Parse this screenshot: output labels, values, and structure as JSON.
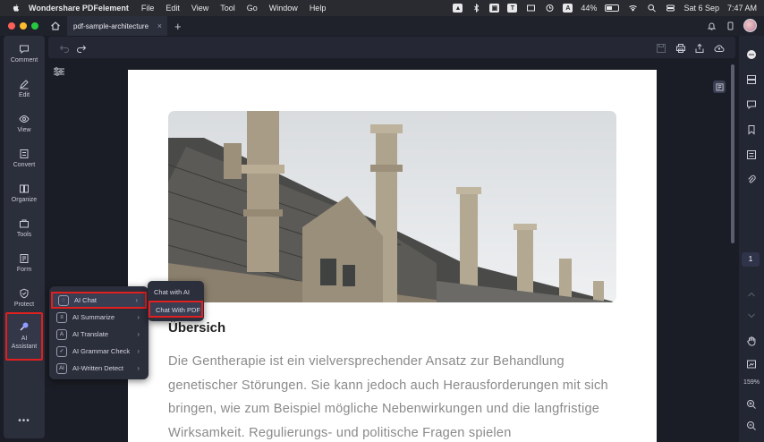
{
  "menubar": {
    "app_name": "Wondershare PDFelement",
    "menus": [
      "File",
      "Edit",
      "View",
      "Tool",
      "Go",
      "Window",
      "Help"
    ],
    "battery": "44%",
    "date": "Sat 6 Sep",
    "time": "7:47 AM",
    "badge_a": "A"
  },
  "tabs": {
    "active_tab": "pdf-sample-architecture",
    "close_glyph": "×",
    "new_tab_glyph": "+"
  },
  "left_sidebar": {
    "items": [
      {
        "label": "Comment",
        "icon": "comment-icon"
      },
      {
        "label": "Edit",
        "icon": "edit-icon"
      },
      {
        "label": "View",
        "icon": "eye-icon"
      },
      {
        "label": "Convert",
        "icon": "convert-icon"
      },
      {
        "label": "Organize",
        "icon": "organize-icon"
      },
      {
        "label": "Tools",
        "icon": "tools-icon"
      },
      {
        "label": "Form",
        "icon": "form-icon"
      },
      {
        "label": "Protect",
        "icon": "shield-icon"
      },
      {
        "label": "AI Assistant",
        "icon": "ai-assistant-icon"
      }
    ],
    "more": "•••"
  },
  "ai_menu": {
    "items": [
      {
        "label": "AI Chat",
        "icon": "ai-chat-icon"
      },
      {
        "label": "AI Summarize",
        "icon": "ai-summarize-icon"
      },
      {
        "label": "AI Translate",
        "icon": "ai-translate-icon"
      },
      {
        "label": "AI Grammar Check",
        "icon": "ai-grammar-check-icon"
      },
      {
        "label": "AI-Written Detect",
        "icon": "ai-written-detect-icon"
      }
    ]
  },
  "ai_chat_flyout": {
    "items": [
      "Chat with AI",
      "Chat With PDF"
    ]
  },
  "document": {
    "heading": "Übersich",
    "paragraph": "Die Gentherapie ist ein vielversprechender Ansatz zur Behandlung genetischer Störungen. Sie kann jedoch auch Herausforderungen mit sich bringen, wie zum Beispiel mögliche Nebenwirkungen und die langfristige Wirksamkeit. Regulierungs- und politische Fragen spielen"
  },
  "right_panel": {
    "page_number": "1",
    "zoom": "159%"
  },
  "colors": {
    "highlight": "#e02020",
    "sidebar_bg": "#2b2e3b",
    "canvas_bg": "#1b1d26"
  }
}
